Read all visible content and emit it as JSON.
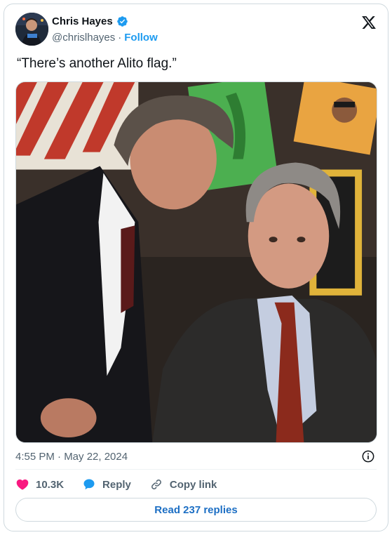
{
  "author": {
    "name": "Chris Hayes",
    "handle": "@chrislhayes",
    "separator": "·",
    "follow_label": "Follow",
    "verified": true,
    "avatar_icon": "profile-avatar"
  },
  "platform_icon": "x-logo-icon",
  "tweet": {
    "text": "“There’s another Alito flag.”",
    "image_description_icon": "photo"
  },
  "meta": {
    "timestamp": "4:55 PM · May 22, 2024",
    "info_icon": "info-icon"
  },
  "actions": {
    "like_count": "10.3K",
    "reply_label": "Reply",
    "copy_label": "Copy link"
  },
  "footer": {
    "read_replies_label": "Read 237 replies"
  },
  "colors": {
    "accent": "#1d9bf0",
    "like": "#f91880",
    "text": "#0f1419",
    "muted": "#536471",
    "border": "#cfd9de"
  }
}
